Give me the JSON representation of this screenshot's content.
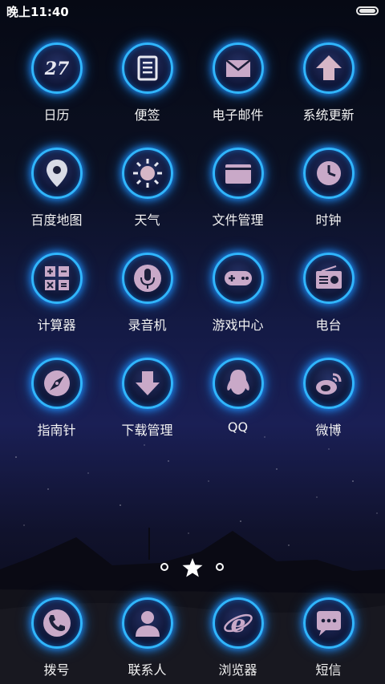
{
  "status": {
    "time": "晚上11:40"
  },
  "apps": [
    {
      "label": "日历",
      "icon": "calendar-icon"
    },
    {
      "label": "便签",
      "icon": "notes-icon"
    },
    {
      "label": "电子邮件",
      "icon": "email-icon"
    },
    {
      "label": "系统更新",
      "icon": "system-update-icon"
    },
    {
      "label": "百度地图",
      "icon": "map-pin-icon"
    },
    {
      "label": "天气",
      "icon": "weather-sun-icon"
    },
    {
      "label": "文件管理",
      "icon": "folder-icon"
    },
    {
      "label": "时钟",
      "icon": "clock-icon"
    },
    {
      "label": "计算器",
      "icon": "calculator-icon"
    },
    {
      "label": "录音机",
      "icon": "microphone-icon"
    },
    {
      "label": "游戏中心",
      "icon": "gamepad-icon"
    },
    {
      "label": "电台",
      "icon": "radio-icon"
    },
    {
      "label": "指南针",
      "icon": "compass-icon"
    },
    {
      "label": "下载管理",
      "icon": "download-icon"
    },
    {
      "label": "QQ",
      "icon": "qq-penguin-icon"
    },
    {
      "label": "微博",
      "icon": "weibo-icon"
    }
  ],
  "pager": {
    "pages": 3,
    "current": 2
  },
  "dock": [
    {
      "label": "拨号",
      "icon": "phone-icon"
    },
    {
      "label": "联系人",
      "icon": "contacts-icon"
    },
    {
      "label": "浏览器",
      "icon": "browser-icon"
    },
    {
      "label": "短信",
      "icon": "message-icon"
    }
  ],
  "colors": {
    "ring": "#30b6ff",
    "glow": "#1e90ff",
    "background": "#141a45"
  }
}
